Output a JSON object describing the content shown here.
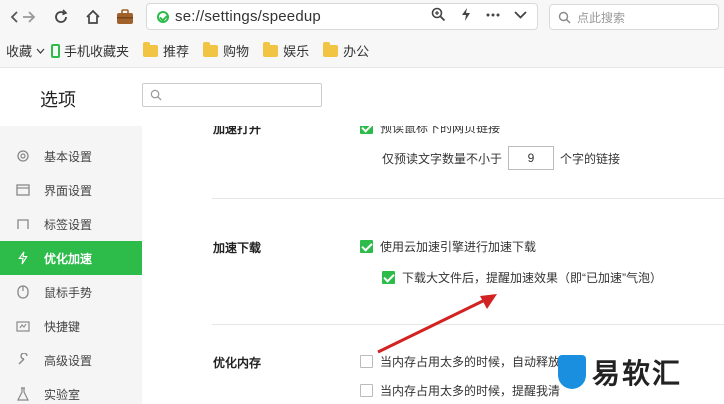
{
  "toolbar": {
    "address_url": "se://settings/speedup",
    "search_placeholder": "点此搜索"
  },
  "bookmarks": {
    "items": [
      {
        "label": "收藏"
      },
      {
        "label": "手机收藏夹"
      },
      {
        "label": "推荐"
      },
      {
        "label": "购物"
      },
      {
        "label": "娱乐"
      },
      {
        "label": "办公"
      }
    ]
  },
  "settings": {
    "title": "选项"
  },
  "sidebar": {
    "items": [
      {
        "label": "基本设置",
        "icon": "gear-icon"
      },
      {
        "label": "界面设置",
        "icon": "window-icon"
      },
      {
        "label": "标签设置",
        "icon": "tab-icon"
      },
      {
        "label": "优化加速",
        "icon": "lightning-icon",
        "active": true
      },
      {
        "label": "鼠标手势",
        "icon": "mouse-icon"
      },
      {
        "label": "快捷键",
        "icon": "keyboard-icon"
      },
      {
        "label": "高级设置",
        "icon": "wrench-icon"
      },
      {
        "label": "实验室",
        "icon": "flask-icon"
      }
    ]
  },
  "content": {
    "sec_open": {
      "label": "加速打开",
      "preload_label": "预读鼠标下的网页链接",
      "preload_checked": true,
      "min_chars_prefix": "仅预读文字数量不小于",
      "min_chars_value": "9",
      "min_chars_suffix": "个字的链接"
    },
    "sec_download": {
      "label": "加速下载",
      "cloud_label": "使用云加速引擎进行加速下载",
      "cloud_checked": true,
      "notify_label": "下载大文件后，提醒加速效果（即“已加速”气泡）",
      "notify_checked": true
    },
    "sec_memory": {
      "label": "优化内存",
      "auto_release_label": "当内存占用太多的时候，自动释放",
      "auto_release_checked": false,
      "remind_label": "当内存占用太多的时候，提醒我清",
      "remind_checked": false
    }
  },
  "watermark": {
    "text": "易软汇"
  },
  "colors": {
    "accent": "#2dbb4a",
    "arrow": "#d32222"
  }
}
